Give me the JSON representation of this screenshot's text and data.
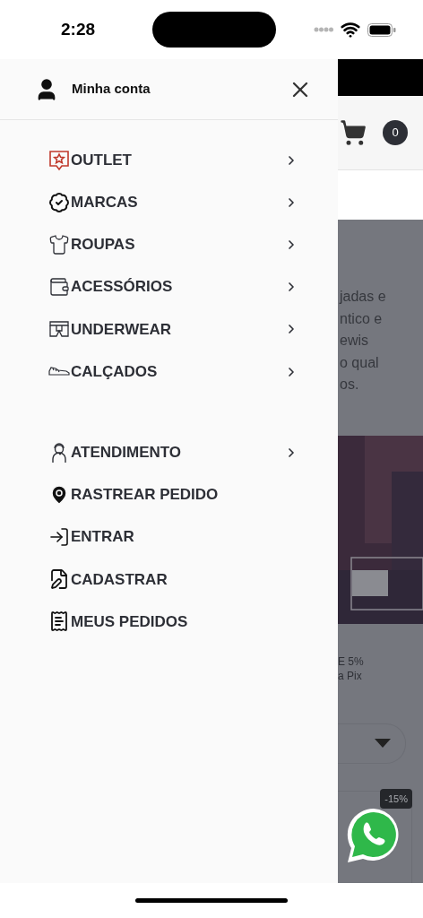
{
  "status_bar": {
    "time": "2:28"
  },
  "drawer": {
    "account_label": "Minha conta",
    "groups": [
      {
        "items": [
          {
            "label": "OUTLET",
            "expandable": true
          },
          {
            "label": "MARCAS",
            "expandable": true
          },
          {
            "label": "ROUPAS",
            "expandable": true
          },
          {
            "label": "ACESSÓRIOS",
            "expandable": true
          },
          {
            "label": "UNDERWEAR",
            "expandable": true
          },
          {
            "label": "CALÇADOS",
            "expandable": true
          }
        ]
      },
      {
        "items": [
          {
            "label": "ATENDIMENTO",
            "expandable": true
          },
          {
            "label": "RASTREAR PEDIDO",
            "expandable": false
          },
          {
            "label": "ENTRAR",
            "expandable": false
          },
          {
            "label": "CADASTRAR",
            "expandable": false
          },
          {
            "label": "MEUS PEDIDOS",
            "expandable": false
          }
        ]
      }
    ]
  },
  "background_page": {
    "cart_count": "0",
    "text_lines": [
      "jadas e",
      "ntico e",
      "ewis",
      "o qual",
      "os."
    ],
    "promo_lines": [
      "E 5%",
      "a Pix"
    ],
    "discount_badge": "-15%"
  }
}
